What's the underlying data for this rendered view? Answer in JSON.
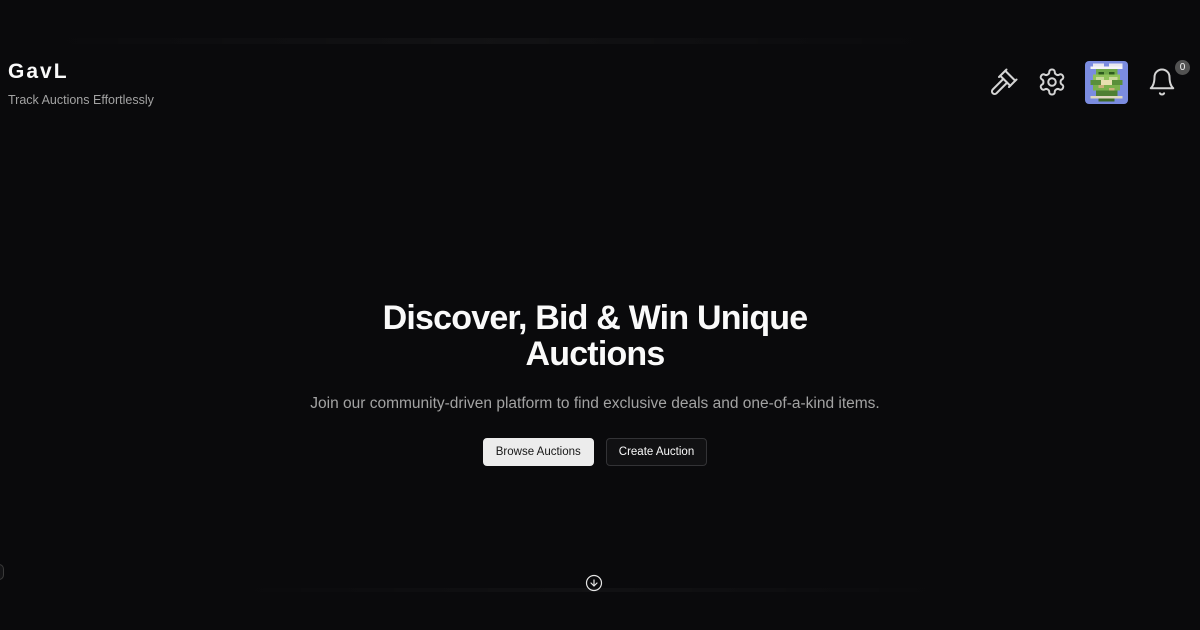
{
  "brand": {
    "name": "GavL",
    "tagline": "Track Auctions Effortlessly"
  },
  "header": {
    "icons": [
      "gavel-icon",
      "gear-icon",
      "avatar",
      "bell-icon"
    ],
    "notifications_count": "0"
  },
  "hero": {
    "title_line1": "Discover, Bid & Win Unique",
    "title_line2": "Auctions",
    "subtitle": "Join our community-driven platform to find exclusive deals and one-of-a-kind items.",
    "primary_button": "Browse Auctions",
    "secondary_button": "Create Auction"
  },
  "colors": {
    "background": "#0a0a0c",
    "text": "#fafafa",
    "muted": "#a3a3a3",
    "avatar_bg": "#7b8ce0"
  }
}
